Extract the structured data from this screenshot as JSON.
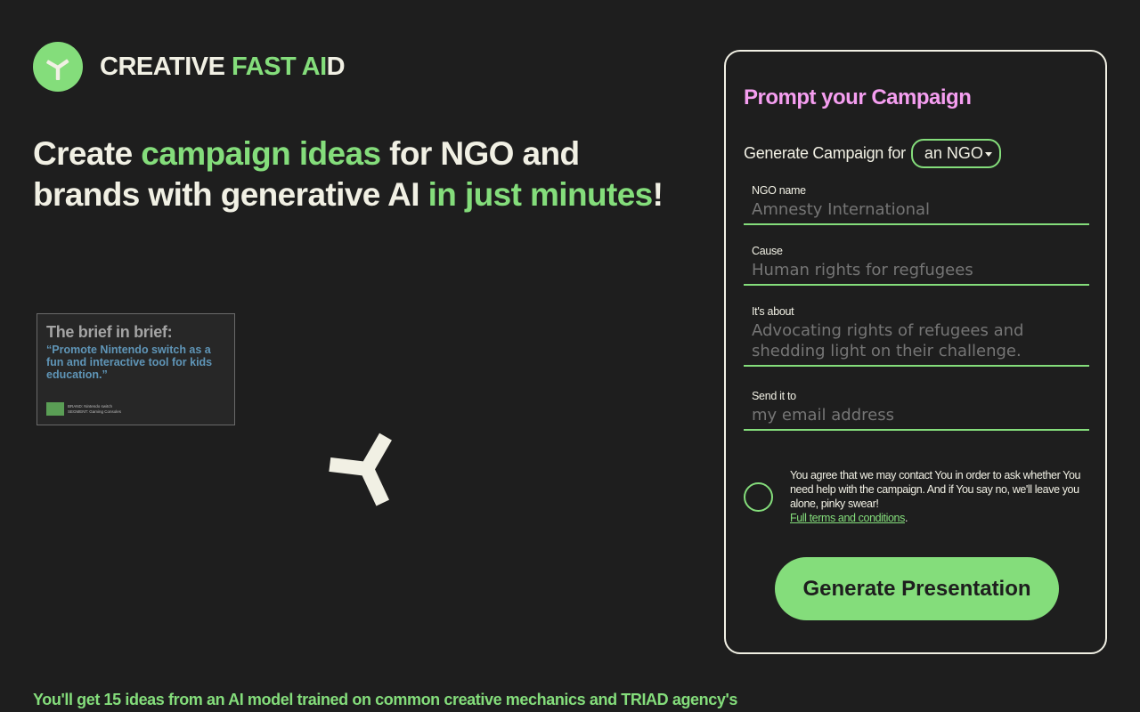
{
  "brand": {
    "name_part1": "CREATIVE",
    "name_part2": "FAST AI",
    "name_part3": "D"
  },
  "headline": {
    "t1": "Create ",
    "t2": "campaign ideas",
    "t3": " for NGO and brands with generative AI ",
    "t4": "in just minutes",
    "t5": "!"
  },
  "brief": {
    "title": "The brief in brief:",
    "quote": "“Promote Nintendo switch as a fun and interactive tool for kids education.”",
    "brand_line": "BRAND: Nintendo switch",
    "segment_line": "SEGMENT: Gaming Consoles"
  },
  "footer": {
    "text": "You'll get 15 ideas from an AI model trained on common creative mechanics and TRIAD agency's"
  },
  "form": {
    "title": "Prompt your Campaign",
    "generate_for_label": "Generate Campaign for",
    "generate_for_value": "an NGO",
    "fields": [
      {
        "label": "NGO name",
        "placeholder": "Amnesty International"
      },
      {
        "label": "Cause",
        "placeholder": "Human rights for regfugees"
      },
      {
        "label": "It's about",
        "placeholder": "Advocating rights of refugees and shedding light on their challenge."
      },
      {
        "label": "Send it to",
        "placeholder": "my email address"
      }
    ],
    "consent_text": "You agree that we may contact You in order to ask whether You need help with the campaign. And if You say no, we'll leave you alone, pinky swear!",
    "terms_link": "Full terms and conditions",
    "terms_suffix": ".",
    "submit_label": "Generate Presentation"
  },
  "colors": {
    "background": "#1e1e1e",
    "accent_green": "#84dd7b",
    "accent_pink": "#f59ef0",
    "text_light": "#f1f0e4",
    "brief_blue": "#5f95b7"
  },
  "icons": {
    "logo": "tri-blade-logo-icon",
    "loader": "tri-blade-spinner-icon",
    "select_caret": "caret-down-icon"
  }
}
